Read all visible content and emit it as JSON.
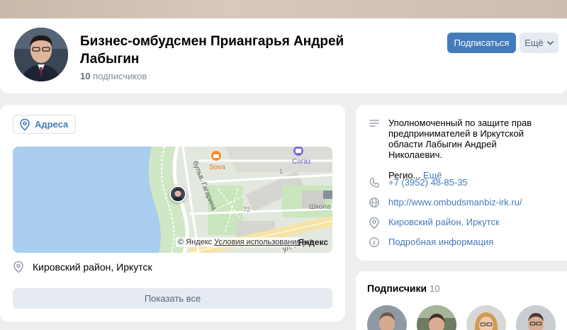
{
  "header": {
    "title": "Бизнес-омбудсмен Приангарья Андрей Лабыгин",
    "subscribers_count": "10",
    "subscribers_word": "подписчиков",
    "subscribe_label": "Подписаться",
    "more_label": "Ещё"
  },
  "addresses": {
    "chip_label": "Адреса",
    "map": {
      "labels": {
        "poi_food": "Sova",
        "poi_insurance": "Согаз",
        "street_1": "бульв. Гагарина",
        "street_2": "ул. Карла",
        "school": "Школа",
        "house_1": "1",
        "house_72": "72"
      },
      "copyright": "© Яндекс",
      "terms": "Условия использования",
      "logo": "Яндекс"
    },
    "address": "Кировский район, Иркутск",
    "show_all_label": "Показать все"
  },
  "info": {
    "description": "Уполномоченный по защите прав предпринимателей в Иркутской области Лабыгин Андрей Николаевич.",
    "description_tail": "Регио...",
    "more_label": "Ещё",
    "phone": "+7 (3952) 48-85-35",
    "website": "http://www.ombudsmanbiz-irk.ru/",
    "location": "Кировский район, Иркутск",
    "details_label": "Подробная информация"
  },
  "followers": {
    "title": "Подписчики",
    "count": "10"
  },
  "colors": {
    "accent": "#447bba",
    "secondary_button": "#e5ebf1",
    "background": "#edeef0",
    "muted_text": "#818c99",
    "map_water": "#a8cdef",
    "icon": "#99a2ad"
  },
  "icons": {
    "location": "location-pin-icon",
    "more_chevron": "chevron-down-icon",
    "description": "text-lines-icon",
    "phone": "phone-icon",
    "website": "globe-icon",
    "details": "info-circle-icon"
  }
}
